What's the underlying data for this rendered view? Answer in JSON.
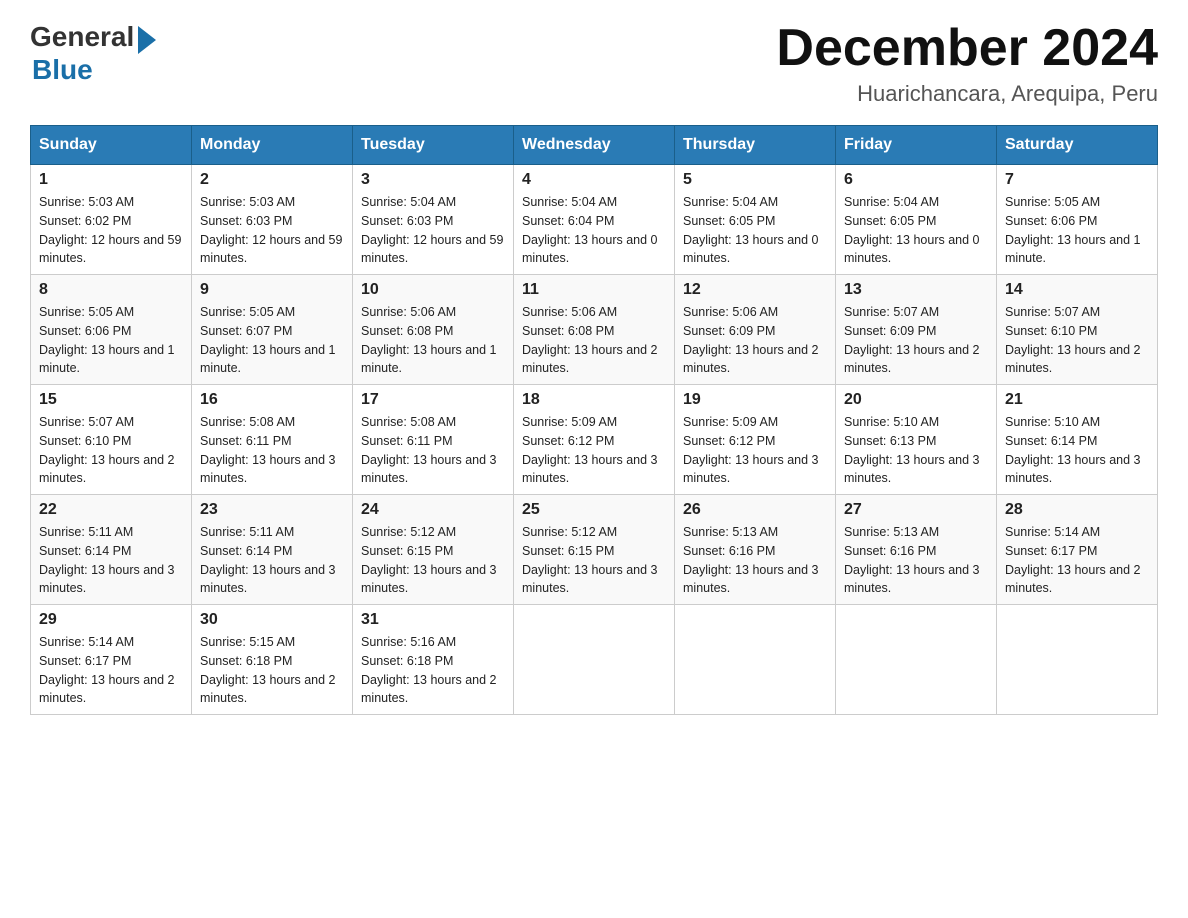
{
  "header": {
    "logo_general": "General",
    "logo_blue": "Blue",
    "month_title": "December 2024",
    "location": "Huarichancara, Arequipa, Peru"
  },
  "weekdays": [
    "Sunday",
    "Monday",
    "Tuesday",
    "Wednesday",
    "Thursday",
    "Friday",
    "Saturday"
  ],
  "weeks": [
    [
      {
        "day": "1",
        "sunrise": "5:03 AM",
        "sunset": "6:02 PM",
        "daylight": "12 hours and 59 minutes."
      },
      {
        "day": "2",
        "sunrise": "5:03 AM",
        "sunset": "6:03 PM",
        "daylight": "12 hours and 59 minutes."
      },
      {
        "day": "3",
        "sunrise": "5:04 AM",
        "sunset": "6:03 PM",
        "daylight": "12 hours and 59 minutes."
      },
      {
        "day": "4",
        "sunrise": "5:04 AM",
        "sunset": "6:04 PM",
        "daylight": "13 hours and 0 minutes."
      },
      {
        "day": "5",
        "sunrise": "5:04 AM",
        "sunset": "6:05 PM",
        "daylight": "13 hours and 0 minutes."
      },
      {
        "day": "6",
        "sunrise": "5:04 AM",
        "sunset": "6:05 PM",
        "daylight": "13 hours and 0 minutes."
      },
      {
        "day": "7",
        "sunrise": "5:05 AM",
        "sunset": "6:06 PM",
        "daylight": "13 hours and 1 minute."
      }
    ],
    [
      {
        "day": "8",
        "sunrise": "5:05 AM",
        "sunset": "6:06 PM",
        "daylight": "13 hours and 1 minute."
      },
      {
        "day": "9",
        "sunrise": "5:05 AM",
        "sunset": "6:07 PM",
        "daylight": "13 hours and 1 minute."
      },
      {
        "day": "10",
        "sunrise": "5:06 AM",
        "sunset": "6:08 PM",
        "daylight": "13 hours and 1 minute."
      },
      {
        "day": "11",
        "sunrise": "5:06 AM",
        "sunset": "6:08 PM",
        "daylight": "13 hours and 2 minutes."
      },
      {
        "day": "12",
        "sunrise": "5:06 AM",
        "sunset": "6:09 PM",
        "daylight": "13 hours and 2 minutes."
      },
      {
        "day": "13",
        "sunrise": "5:07 AM",
        "sunset": "6:09 PM",
        "daylight": "13 hours and 2 minutes."
      },
      {
        "day": "14",
        "sunrise": "5:07 AM",
        "sunset": "6:10 PM",
        "daylight": "13 hours and 2 minutes."
      }
    ],
    [
      {
        "day": "15",
        "sunrise": "5:07 AM",
        "sunset": "6:10 PM",
        "daylight": "13 hours and 2 minutes."
      },
      {
        "day": "16",
        "sunrise": "5:08 AM",
        "sunset": "6:11 PM",
        "daylight": "13 hours and 3 minutes."
      },
      {
        "day": "17",
        "sunrise": "5:08 AM",
        "sunset": "6:11 PM",
        "daylight": "13 hours and 3 minutes."
      },
      {
        "day": "18",
        "sunrise": "5:09 AM",
        "sunset": "6:12 PM",
        "daylight": "13 hours and 3 minutes."
      },
      {
        "day": "19",
        "sunrise": "5:09 AM",
        "sunset": "6:12 PM",
        "daylight": "13 hours and 3 minutes."
      },
      {
        "day": "20",
        "sunrise": "5:10 AM",
        "sunset": "6:13 PM",
        "daylight": "13 hours and 3 minutes."
      },
      {
        "day": "21",
        "sunrise": "5:10 AM",
        "sunset": "6:14 PM",
        "daylight": "13 hours and 3 minutes."
      }
    ],
    [
      {
        "day": "22",
        "sunrise": "5:11 AM",
        "sunset": "6:14 PM",
        "daylight": "13 hours and 3 minutes."
      },
      {
        "day": "23",
        "sunrise": "5:11 AM",
        "sunset": "6:14 PM",
        "daylight": "13 hours and 3 minutes."
      },
      {
        "day": "24",
        "sunrise": "5:12 AM",
        "sunset": "6:15 PM",
        "daylight": "13 hours and 3 minutes."
      },
      {
        "day": "25",
        "sunrise": "5:12 AM",
        "sunset": "6:15 PM",
        "daylight": "13 hours and 3 minutes."
      },
      {
        "day": "26",
        "sunrise": "5:13 AM",
        "sunset": "6:16 PM",
        "daylight": "13 hours and 3 minutes."
      },
      {
        "day": "27",
        "sunrise": "5:13 AM",
        "sunset": "6:16 PM",
        "daylight": "13 hours and 3 minutes."
      },
      {
        "day": "28",
        "sunrise": "5:14 AM",
        "sunset": "6:17 PM",
        "daylight": "13 hours and 2 minutes."
      }
    ],
    [
      {
        "day": "29",
        "sunrise": "5:14 AM",
        "sunset": "6:17 PM",
        "daylight": "13 hours and 2 minutes."
      },
      {
        "day": "30",
        "sunrise": "5:15 AM",
        "sunset": "6:18 PM",
        "daylight": "13 hours and 2 minutes."
      },
      {
        "day": "31",
        "sunrise": "5:16 AM",
        "sunset": "6:18 PM",
        "daylight": "13 hours and 2 minutes."
      },
      null,
      null,
      null,
      null
    ]
  ]
}
